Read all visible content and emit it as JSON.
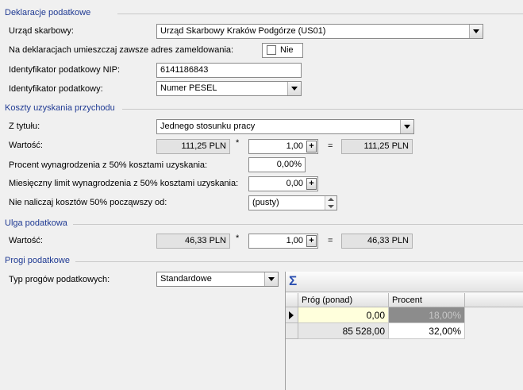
{
  "sections": {
    "deklaracje": "Deklaracje podatkowe",
    "koszty": "Koszty uzyskania przychodu",
    "ulga": "Ulga podatkowa",
    "progi": "Progi podatkowe"
  },
  "deklaracje": {
    "urzad_label": "Urząd skarbowy:",
    "urzad_value": "Urząd Skarbowy Kraków Podgórze (US01)",
    "adres_label": "Na deklaracjach umieszczaj zawsze adres zameldowania:",
    "adres_value": "Nie",
    "nip_label": "Identyfikator podatkowy NIP:",
    "nip_value": "6141186843",
    "ident_label": "Identyfikator podatkowy:",
    "ident_value": "Numer PESEL"
  },
  "koszty": {
    "tytul_label": "Z tytułu:",
    "tytul_value": "Jednego stosunku pracy",
    "wartosc_label": "Wartość:",
    "wartosc_base": "111,25 PLN",
    "wartosc_mult_op": "*",
    "wartosc_factor": "1,00",
    "wartosc_eq": "=",
    "wartosc_result": "111,25 PLN",
    "procent_label": "Procent wynagrodzenia z 50% kosztami uzyskania:",
    "procent_value": "0,00%",
    "limit_label": "Miesięczny limit wynagrodzenia z 50% kosztami uzyskania:",
    "limit_value": "0,00",
    "nie_naliczaj_label": "Nie naliczaj kosztów 50% począwszy od:",
    "nie_naliczaj_value": "(pusty)"
  },
  "ulga": {
    "wartosc_label": "Wartość:",
    "base": "46,33 PLN",
    "mult_op": "*",
    "factor": "1,00",
    "eq": "=",
    "result": "46,33 PLN"
  },
  "progi": {
    "typ_label": "Typ progów podatkowych:",
    "typ_value": "Standardowe",
    "grid": {
      "columns": [
        "Próg (ponad)",
        "Procent"
      ],
      "rows": [
        {
          "prog": "0,00",
          "procent": "18,00%"
        },
        {
          "prog": "85 528,00",
          "procent": "32,00%"
        }
      ]
    }
  },
  "icons": {
    "sigma": "Σ",
    "plus": "+"
  }
}
